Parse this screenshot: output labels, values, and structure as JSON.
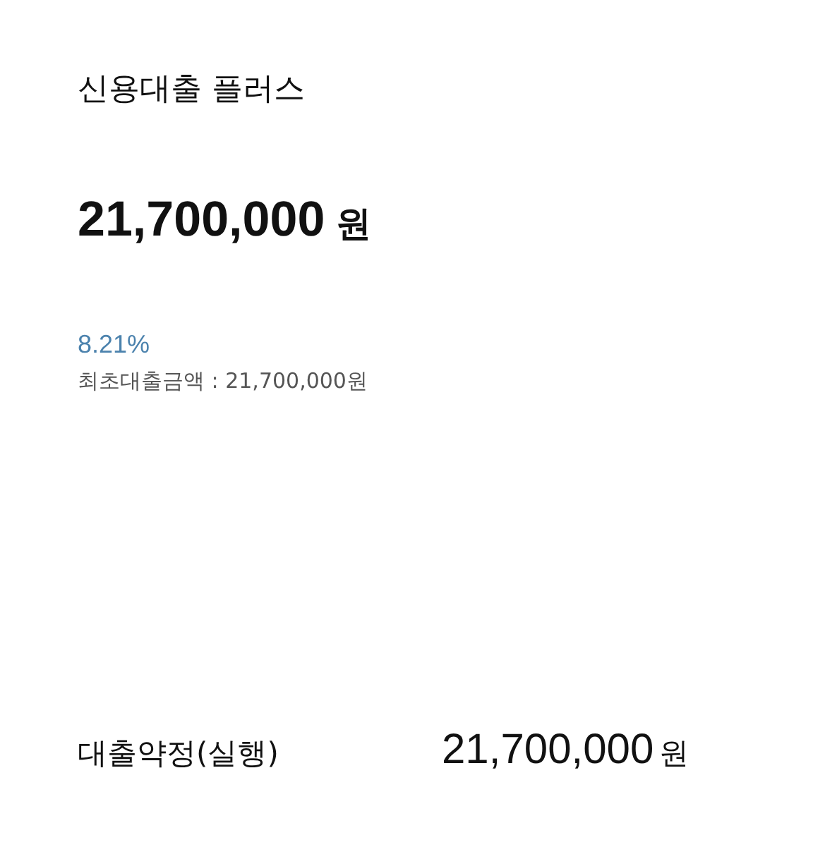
{
  "product": {
    "title": "신용대출 플러스"
  },
  "balance": {
    "amount": "21,700,000",
    "unit": "원"
  },
  "rate": "8.21%",
  "initial_amount": "최초대출금액 : 21,700,000원",
  "contract": {
    "label": "대출약정(실행)",
    "amount": "21,700,000",
    "unit": "원"
  }
}
